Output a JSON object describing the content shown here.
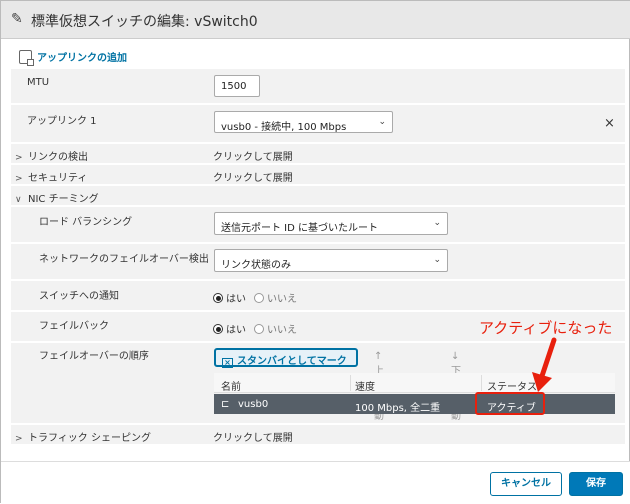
{
  "dialog": {
    "title": "標準仮想スイッチの編集: vSwitch0",
    "add_uplink": "アップリンクの追加"
  },
  "form": {
    "mtu": {
      "label": "MTU",
      "value": "1500"
    },
    "uplink1": {
      "label": "アップリンク 1",
      "value": "vusb0 - 接続中, 100 Mbps",
      "remove": "×"
    },
    "link_detection": {
      "label": "リンクの検出",
      "value": "クリックして展開"
    },
    "security": {
      "label": "セキュリティ",
      "value": "クリックして展開"
    },
    "nic_teaming": {
      "label": "NIC チーミング"
    },
    "load_balancing": {
      "label": "ロード バランシング",
      "value": "送信元ポート ID に基づいたルート"
    },
    "failure_detection": {
      "label": "ネットワークのフェイルオーバー検出",
      "value": "リンク状態のみ"
    },
    "notify_switches": {
      "label": "スイッチへの通知",
      "yes": "はい",
      "no": "いいえ",
      "selected": "yes"
    },
    "failback": {
      "label": "フェイルバック",
      "yes": "はい",
      "no": "いいえ",
      "selected": "yes"
    },
    "failover_order": {
      "label": "フェイルオーバーの順序",
      "mark_standby": "スタンバイとしてマーク",
      "move_up": "上へ移動",
      "move_down": "下へ移動",
      "columns": [
        "名前",
        "速度",
        "ステータス"
      ],
      "rows": [
        {
          "name": "vusb0",
          "speed": "100 Mbps, 全二重",
          "status": "アクティブ"
        }
      ]
    },
    "traffic_shaping": {
      "label": "トラフィック シェーピング",
      "value": "クリックして展開"
    }
  },
  "annotation": {
    "text": "アクティブになった",
    "color": "#e8200d"
  },
  "footer": {
    "cancel": "キャンセル",
    "save": "保存"
  },
  "colors": {
    "accent": "#0072a3",
    "selected_row": "#565f68",
    "row_bg": "#f2f2f2"
  }
}
